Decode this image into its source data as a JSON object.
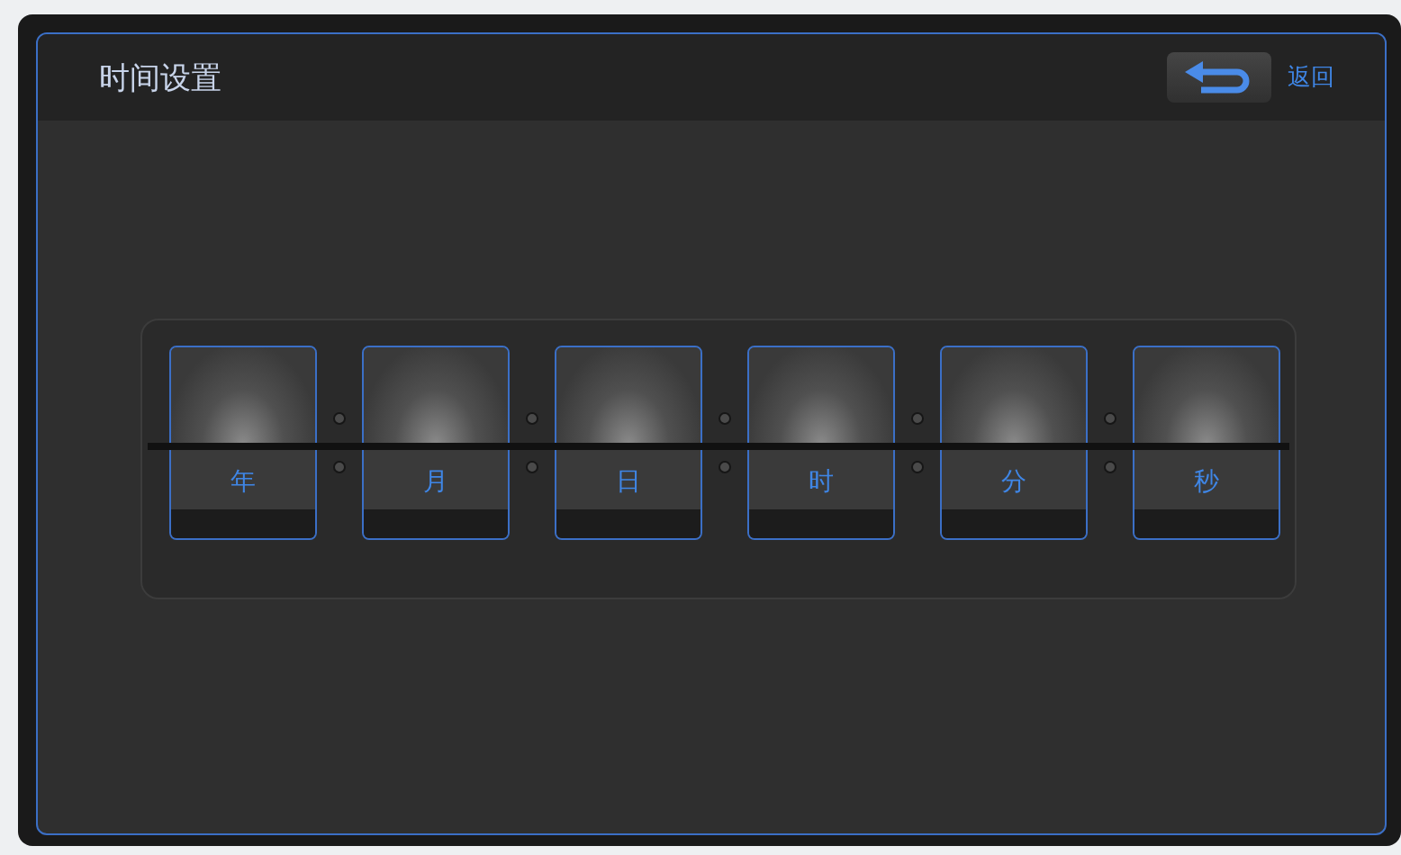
{
  "header": {
    "title": "时间设置",
    "back_label": "返回"
  },
  "fields": [
    {
      "label": "年"
    },
    {
      "label": "月"
    },
    {
      "label": "日"
    },
    {
      "label": "时"
    },
    {
      "label": "分"
    },
    {
      "label": "秒"
    }
  ]
}
